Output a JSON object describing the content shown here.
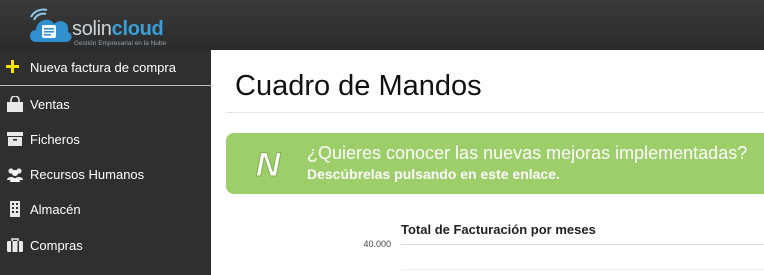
{
  "brand": {
    "name_part1": "solin",
    "name_part2": "cloud",
    "tagline": "Gestión Empresarial en la Nube"
  },
  "sidebar": {
    "new_invoice_label": "Nueva factura de compra",
    "items": [
      {
        "label": "Ventas",
        "icon": "shopping-bag-icon"
      },
      {
        "label": "Ficheros",
        "icon": "box-icon"
      },
      {
        "label": "Recursos Humanos",
        "icon": "people-icon"
      },
      {
        "label": "Almacén",
        "icon": "building-icon"
      },
      {
        "label": "Compras",
        "icon": "briefcase-icon"
      }
    ]
  },
  "main": {
    "title": "Cuadro de Mandos",
    "banner": {
      "question": "¿Quieres conocer las nuevas mejoras implementadas?",
      "cta": "Descúbrelas pulsando en este enlace.",
      "badge_letter": "N"
    },
    "chart": {
      "title": "Total de Facturación por meses",
      "y_ticks": [
        "40.000"
      ]
    }
  },
  "chart_data": {
    "type": "bar",
    "title": "Total de Facturación por meses",
    "yticks": [
      "40.000"
    ],
    "grid": true
  },
  "colors": {
    "topbar": "#2f2f2f",
    "sidebar": "#2f2f2f",
    "banner": "#9ccf69",
    "accent_cloud": "#3a9fd8",
    "plus_icon": "#f4e400"
  }
}
